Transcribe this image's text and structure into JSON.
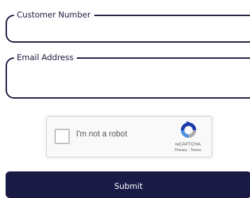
{
  "form": {
    "customer_number": {
      "label": "Customer Number",
      "value": "",
      "placeholder": ""
    },
    "email": {
      "label": "Email Address",
      "value": "",
      "placeholder": ""
    }
  },
  "recaptcha": {
    "label": "I'm not a robot",
    "brand": "reCAPTCHA",
    "privacy": "Privacy",
    "separator": " - ",
    "terms": "Terms",
    "checked": false,
    "logo_icon": "recaptcha-logo-icon"
  },
  "submit": {
    "label": "Submit"
  },
  "colors": {
    "primary": "#1a1a47",
    "border": "#161a3d",
    "recaptcha_blue": "#1c3aa9",
    "recaptcha_light_blue": "#4a90e2",
    "recaptcha_gray": "#ababab"
  }
}
